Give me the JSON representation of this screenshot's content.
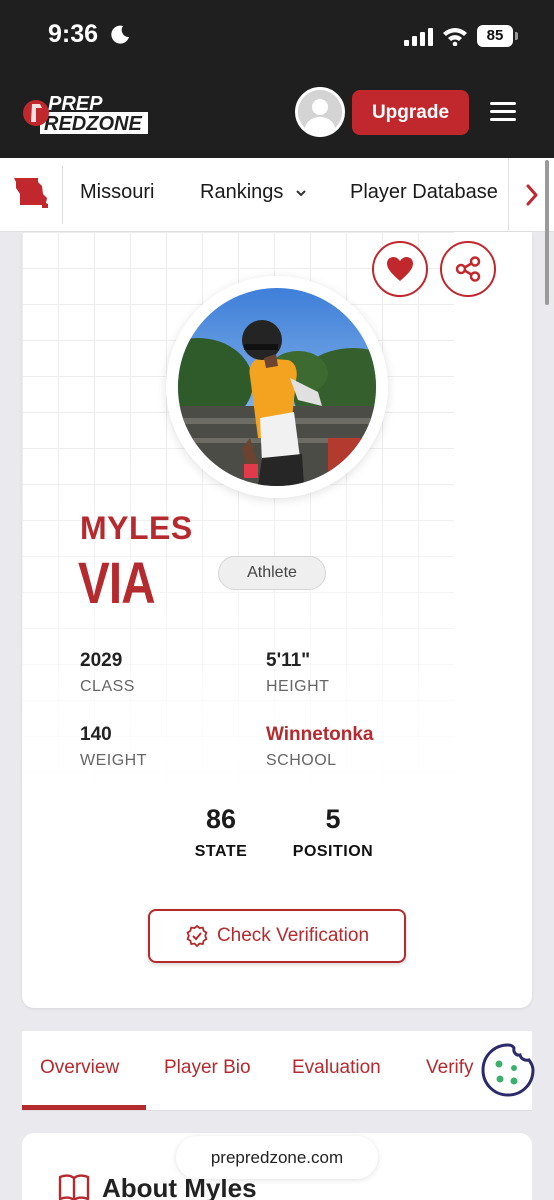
{
  "status_bar": {
    "time": "9:36",
    "battery": "85"
  },
  "header": {
    "logo_line1": "PREP",
    "logo_line2": "REDZONE",
    "upgrade_label": "Upgrade"
  },
  "subnav": {
    "items": [
      {
        "label": "Missouri"
      },
      {
        "label": "Rankings"
      },
      {
        "label": "Player Database"
      }
    ]
  },
  "profile": {
    "first_name": "MYLES",
    "last_name": "VIA",
    "position": "Athlete",
    "stats": {
      "class_value": "2029",
      "class_label": "CLASS",
      "height_value": "5'11\"",
      "height_label": "HEIGHT",
      "weight_value": "140",
      "weight_label": "WEIGHT",
      "school_value": "Winnetonka",
      "school_label": "SCHOOL"
    },
    "rankings": {
      "state_value": "86",
      "state_label": "STATE",
      "position_value": "5",
      "position_label": "POSITION"
    },
    "verify_label": "Check Verification"
  },
  "tabs": [
    {
      "label": "Overview"
    },
    {
      "label": "Player Bio"
    },
    {
      "label": "Evaluation"
    },
    {
      "label": "Verify"
    }
  ],
  "about": {
    "title": "About Myles"
  },
  "browser": {
    "url": "prepredzone.com"
  },
  "colors": {
    "brand_red": "#c0282d",
    "dark_header": "#1f1f1f"
  }
}
